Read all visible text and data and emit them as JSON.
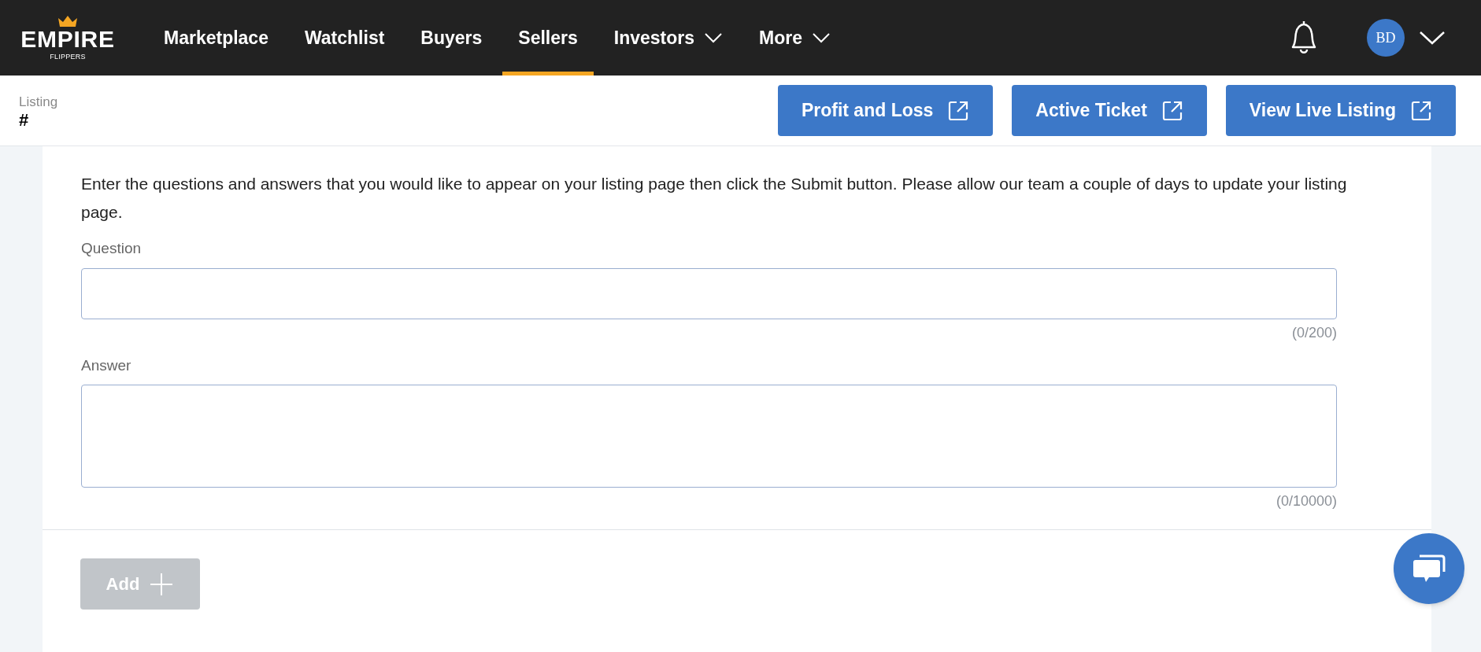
{
  "logo": {
    "word": "EMPIRE",
    "sub": "FLIPPERS"
  },
  "nav": [
    {
      "label": "Marketplace",
      "selected": false,
      "dropdown": false
    },
    {
      "label": "Watchlist",
      "selected": false,
      "dropdown": false
    },
    {
      "label": "Buyers",
      "selected": false,
      "dropdown": false
    },
    {
      "label": "Sellers",
      "selected": true,
      "dropdown": false
    },
    {
      "label": "Investors",
      "selected": false,
      "dropdown": true
    },
    {
      "label": "More",
      "selected": false,
      "dropdown": true
    }
  ],
  "user": {
    "initials": "BD"
  },
  "listing": {
    "label": "Listing",
    "number": "#"
  },
  "actions": [
    "Profit and Loss",
    "Active Ticket",
    "View Live Listing"
  ],
  "form": {
    "intro": "Enter the questions and answers that you would like to appear on your listing page then click the Submit button. Please allow our team a couple of days to update your listing page.",
    "fields": [
      {
        "label": "Question",
        "counter": "(0/200)",
        "kind": "input"
      },
      {
        "label": "Answer",
        "counter": "(0/10000)",
        "kind": "textarea"
      }
    ],
    "add_button": {
      "label": "Add",
      "disabled": true
    }
  }
}
